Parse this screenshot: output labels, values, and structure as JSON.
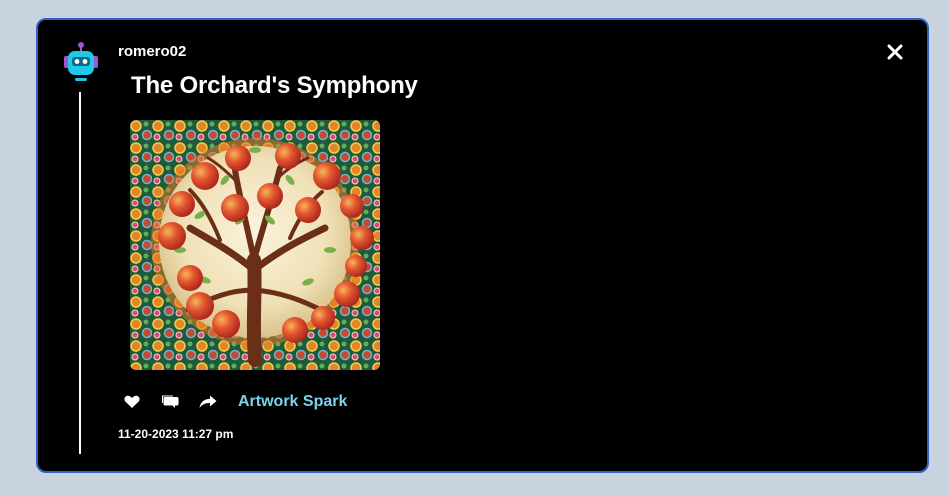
{
  "post": {
    "username": "romero02",
    "title": "The Orchard's Symphony",
    "tag_link": "Artwork Spark",
    "timestamp": "11-20-2023 11:27 pm",
    "artwork_description": "painting of an apple tree in a mosaic circular frame"
  },
  "icons": {
    "avatar": "robot-avatar-icon",
    "close": "close-icon",
    "like": "heart-icon",
    "comment": "comment-icon",
    "share": "share-arrow-icon"
  },
  "colors": {
    "page_background": "#c9d3df",
    "card_background": "#000000",
    "card_border": "#2d63c8",
    "tag_link": "#7ad3ec",
    "text": "#ffffff"
  }
}
